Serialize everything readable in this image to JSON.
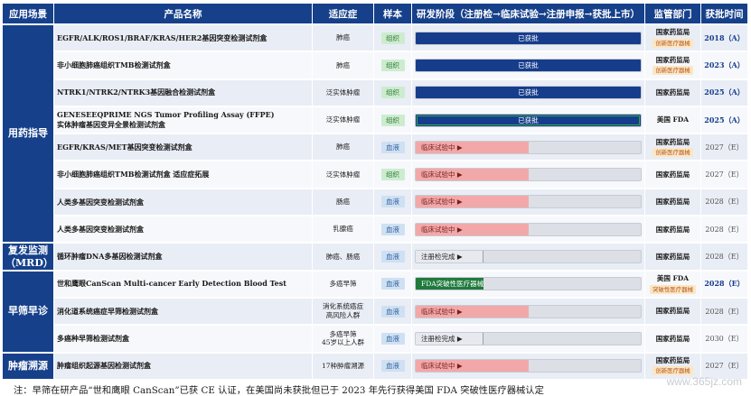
{
  "header": {
    "scene": "应用场景",
    "product": "产品名称",
    "indication": "适应症",
    "sample": "样本",
    "stage": "研发阶段（注册检→临床试验→注册申报→获批上市）",
    "regulator": "监管部门",
    "time": "获批时间"
  },
  "groups": [
    {
      "label": "用药指导",
      "rows": 8
    },
    {
      "label": "复发监测\n（MRD）",
      "rows": 1
    },
    {
      "label": "早筛早诊",
      "rows": 3
    },
    {
      "label": "肿瘤溯源",
      "rows": 1
    }
  ],
  "rows": [
    {
      "product": "EGFR/ALK/ROS1/BRAF/KRAS/HER2基因突变检测试剂盒",
      "indication": "肺癌",
      "sample": "组织",
      "sample_type": "tissue",
      "stage_type": "approved",
      "stage": "已获批",
      "stage_progress": 1.0,
      "regulator": "国家药监局",
      "badge": "创新医疗器械",
      "time": "2018（A）",
      "time_type": "actual"
    },
    {
      "product": "非小细胞肺癌组织TMB检测试剂盒",
      "indication": "肺癌",
      "sample": "组织",
      "sample_type": "tissue",
      "stage_type": "approved",
      "stage": "已获批",
      "stage_progress": 1.0,
      "regulator": "国家药监局",
      "badge": "创新医疗器械",
      "time": "2023（A）",
      "time_type": "actual"
    },
    {
      "product": "NTRK1/NTRK2/NTRK3基因融合检测试剂盒",
      "indication": "泛实体肿瘤",
      "sample": "组织",
      "sample_type": "tissue",
      "stage_type": "approved",
      "stage": "已获批",
      "stage_progress": 1.0,
      "regulator": "国家药监局",
      "badge": "",
      "time": "2025（A）",
      "time_type": "actual"
    },
    {
      "product": "GENESEEQPRIME NGS Tumor Profiling Assay (FFPE)\n实体肿瘤基因变异全景检测试剂盒",
      "indication": "泛实体肿瘤",
      "sample": "组织",
      "sample_type": "tissue",
      "stage_type": "fda-approved",
      "stage": "已获批",
      "stage_progress": 1.0,
      "regulator": "美国 FDA",
      "badge": "",
      "time": "2025（A）",
      "time_type": "actual"
    },
    {
      "product": "EGFR/KRAS/MET基因突变检测试剂盒",
      "indication": "肺癌",
      "sample": "血液",
      "sample_type": "blood",
      "stage_type": "trial",
      "stage": "临床试验中 ▶",
      "stage_progress": 0.5,
      "regulator": "国家药监局",
      "badge": "创新医疗器械",
      "time": "2027（E）",
      "time_type": "est"
    },
    {
      "product": "非小细胞肺癌组织TMB检测试剂盒 适应症拓展",
      "indication": "泛实体肿瘤",
      "sample": "组织",
      "sample_type": "tissue",
      "stage_type": "trial",
      "stage": "临床试验中 ▶",
      "stage_progress": 0.5,
      "regulator": "国家药监局",
      "badge": "",
      "time": "2027（E）",
      "time_type": "est"
    },
    {
      "product": "人类多基因突变检测试剂盒",
      "indication": "肠癌",
      "sample": "血液",
      "sample_type": "blood",
      "stage_type": "trial",
      "stage": "临床试验中 ▶",
      "stage_progress": 0.5,
      "regulator": "国家药监局",
      "badge": "",
      "time": "2028（E）",
      "time_type": "est"
    },
    {
      "product": "人类多基因突变检测试剂盒",
      "indication": "乳腺癌",
      "sample": "血液",
      "sample_type": "blood",
      "stage_type": "trial",
      "stage": "临床试验中 ▶",
      "stage_progress": 0.5,
      "regulator": "国家药监局",
      "badge": "",
      "time": "2028（E）",
      "time_type": "est"
    },
    {
      "product": "循环肿瘤DNA多基因检测试剂盒",
      "indication": "肺癌、肠癌",
      "sample": "血液",
      "sample_type": "blood",
      "stage_type": "reg",
      "stage": "注册检完成 ▶",
      "stage_progress": 0.3,
      "regulator": "国家药监局",
      "badge": "",
      "time": "2028（E）",
      "time_type": "est"
    },
    {
      "product": "世和鹰眼CanScan Multi-cancer Early Detection Blood Test",
      "indication": "多癌早筛",
      "sample": "血液",
      "sample_type": "blood",
      "stage_type": "fda",
      "stage": "FDA突破性医疗器械",
      "stage_progress": 0.3,
      "regulator": "美国 FDA",
      "badge": "突破性医疗器械",
      "time": "2028（E）",
      "time_type": "actual"
    },
    {
      "product": "消化道系统癌症早筛检测试剂盒",
      "indication": "消化系统癌症\n高风险人群",
      "sample": "血液",
      "sample_type": "blood",
      "stage_type": "trial",
      "stage": "临床试验中 ▶",
      "stage_progress": 0.5,
      "regulator": "国家药监局",
      "badge": "",
      "time": "2028（E）",
      "time_type": "est"
    },
    {
      "product": "多癌种早筛检测试剂盒",
      "indication": "多癌早筛\n45岁以上人群",
      "sample": "血液",
      "sample_type": "blood",
      "stage_type": "reg",
      "stage": "注册检完成 ▶",
      "stage_progress": 0.3,
      "regulator": "国家药监局",
      "badge": "",
      "time": "2030（E）",
      "time_type": "est"
    },
    {
      "product": "肿瘤组织起源基因检测试剂盒",
      "indication": "17种肿瘤溯源",
      "sample": "血液",
      "sample_type": "blood",
      "stage_type": "trial",
      "stage": "临床试验中 ▶",
      "stage_progress": 0.5,
      "regulator": "国家药监局",
      "badge": "创新医疗器械",
      "time": "2027（E）",
      "time_type": "est"
    }
  ],
  "note": "注：早筛在研产品“世和鹰眼 CanScan”已获 CE 认证，在美国尚未获批但已于 2023 年先行获得美国 FDA 突破性医疗器械认定",
  "watermark": "www.365jz.com"
}
